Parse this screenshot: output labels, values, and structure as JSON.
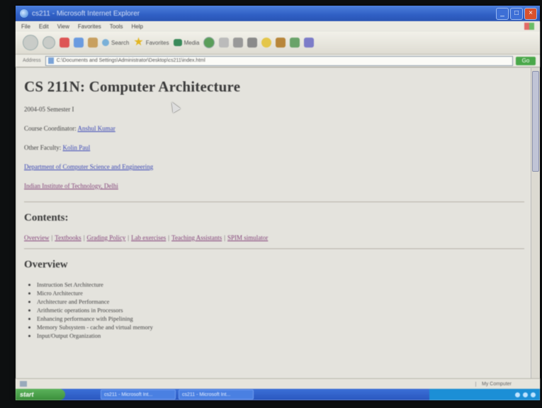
{
  "window": {
    "title": "cs211 - Microsoft Internet Explorer"
  },
  "menu": [
    "File",
    "Edit",
    "View",
    "Favorites",
    "Tools",
    "Help"
  ],
  "toolbar": {
    "search_label": "Search",
    "favorites_label": "Favorites",
    "media_label": "Media"
  },
  "address": {
    "label": "Address",
    "url": "C:\\Documents and Settings\\Administrator\\Desktop\\cs211\\index.html",
    "go_label": "Go"
  },
  "page": {
    "title": "CS 211N: Computer Architecture",
    "semester": "2004-05 Semester I",
    "coordinator_label": "Course Coordinator: ",
    "coordinator_name": "Anshul Kumar",
    "faculty_label": "Other Faculty: ",
    "faculty_name": "Kolin Paul",
    "dept_link": "Department of Computer Science and Engineering",
    "inst_link": "Indian Institute of Technology, Delhi",
    "contents_heading": "Contents:",
    "contents_links": [
      "Overview",
      "Textbooks",
      "Grading Policy",
      "Lab exercises",
      "Teaching Assistants",
      "SPIM simulator"
    ],
    "overview_heading": "Overview",
    "overview_items": [
      "Instruction Set Architecture",
      "Micro Architecture",
      "Architecture and Performance",
      "Arithmetic operations in Processors",
      "Enhancing performance with Pipelining",
      "Memory Subsystem - cache and virtual memory",
      "Input/Output Organization"
    ]
  },
  "status": {
    "zone": "My Computer"
  },
  "taskbar": {
    "start": "start",
    "tasks": [
      "cs211 - Microsoft Int...",
      "cs211 - Microsoft Int..."
    ]
  }
}
